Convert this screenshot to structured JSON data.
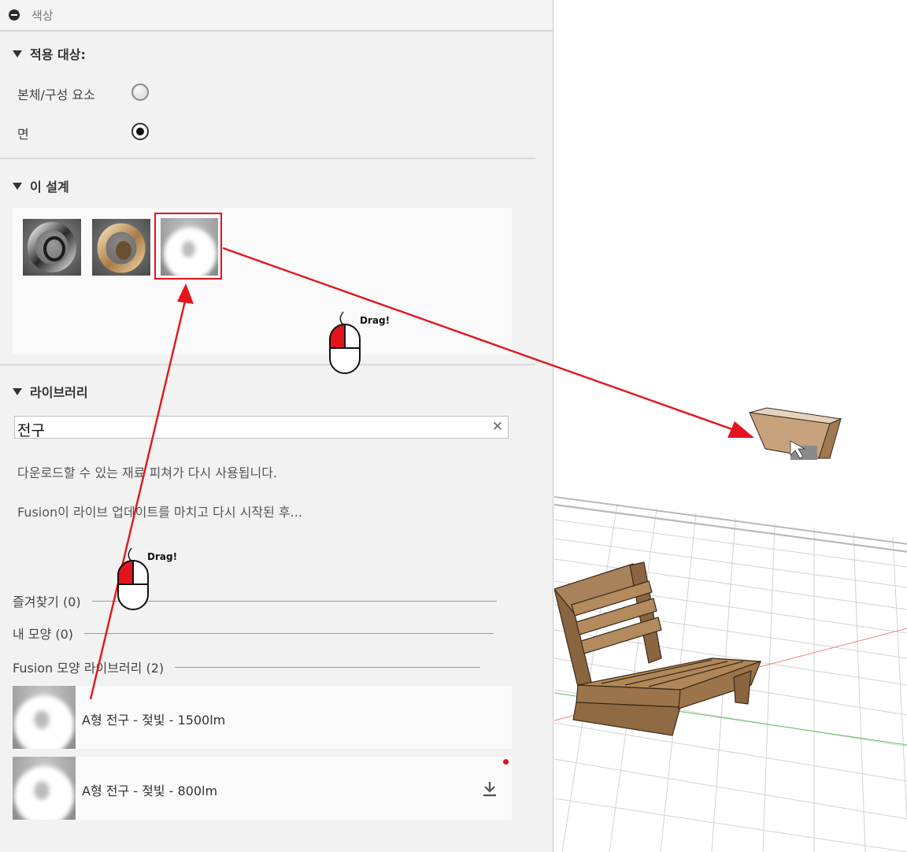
{
  "panel": {
    "title": "색상"
  },
  "apply_to": {
    "heading": "적용 대상:",
    "options": [
      {
        "label": "본체/구성 요소",
        "selected": false
      },
      {
        "label": "면",
        "selected": true
      }
    ]
  },
  "this_design": {
    "heading": "이 설계",
    "thumbnails": [
      "chrome-torus-swatch",
      "wood-torus-swatch",
      "white-bulb-swatch"
    ],
    "selected_index": 2
  },
  "library": {
    "heading": "라이브러리",
    "search": {
      "value": "전구"
    },
    "messages": [
      "다운로드할 수 있는 재료 피쳐가 다시 사용됩니다.",
      "Fusion이 라이브 업데이트를 마치고 다시 시작된 후..."
    ],
    "categories": [
      {
        "label": "즐겨찾기 (0)"
      },
      {
        "label": "내 모양 (0)"
      },
      {
        "label": "Fusion 모양 라이브러리 (2)"
      }
    ],
    "items": [
      {
        "label": "A형 전구 - 젖빛 - 1500lm",
        "downloadable": false
      },
      {
        "label": "A형 전구 - 젖빛 - 800lm",
        "downloadable": true
      }
    ]
  },
  "annotations": {
    "drag_label_1": "Drag!",
    "drag_label_2": "Drag!",
    "accent_color": "#e4141e"
  }
}
